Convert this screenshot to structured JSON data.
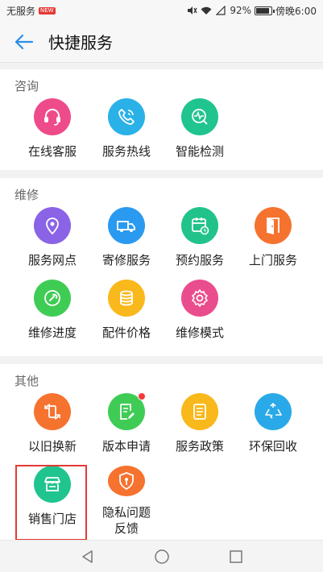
{
  "status_bar": {
    "carrier": "无服务",
    "badge": "NEW",
    "battery": "92%",
    "time": "傍晚6:00"
  },
  "header": {
    "title": "快捷服务"
  },
  "sections": {
    "consult": {
      "title": "咨询",
      "items": [
        {
          "label": "在线客服",
          "color": "#ee4b8b",
          "icon": "headset-icon"
        },
        {
          "label": "服务热线",
          "color": "#2ab1e8",
          "icon": "phone-icon"
        },
        {
          "label": "智能检测",
          "color": "#20c48e",
          "icon": "diagnostics-icon"
        }
      ]
    },
    "repair": {
      "title": "维修",
      "items": [
        {
          "label": "服务网点",
          "color": "#8b63e6",
          "icon": "location-pin-icon"
        },
        {
          "label": "寄修服务",
          "color": "#2a9af0",
          "icon": "delivery-truck-icon"
        },
        {
          "label": "预约服务",
          "color": "#22c38a",
          "icon": "calendar-clock-icon"
        },
        {
          "label": "上门服务",
          "color": "#f6722f",
          "icon": "door-icon"
        },
        {
          "label": "维修进度",
          "color": "#3fcc55",
          "icon": "wrench-icon"
        },
        {
          "label": "配件价格",
          "color": "#f9b81b",
          "icon": "coins-icon"
        },
        {
          "label": "维修模式",
          "color": "#ea4d8d",
          "icon": "gear-icon"
        }
      ]
    },
    "other": {
      "title": "其他",
      "items": [
        {
          "label": "以旧换新",
          "color": "#f6722f",
          "icon": "trade-in-icon"
        },
        {
          "label": "版本申请",
          "color": "#3fcc55",
          "icon": "document-edit-icon",
          "has_dot": true
        },
        {
          "label": "服务政策",
          "color": "#f9b81b",
          "icon": "list-document-icon"
        },
        {
          "label": "环保回收",
          "color": "#29a9e8",
          "icon": "recycle-icon"
        },
        {
          "label": "销售门店",
          "color": "#20c48e",
          "icon": "store-icon"
        },
        {
          "label": "隐私问题反馈",
          "color": "#f6722f",
          "icon": "privacy-shield-icon"
        }
      ]
    }
  },
  "colors": {
    "accent": "#2a90e8",
    "highlight": "#e53935",
    "badge_dot": "#f23a3a"
  }
}
